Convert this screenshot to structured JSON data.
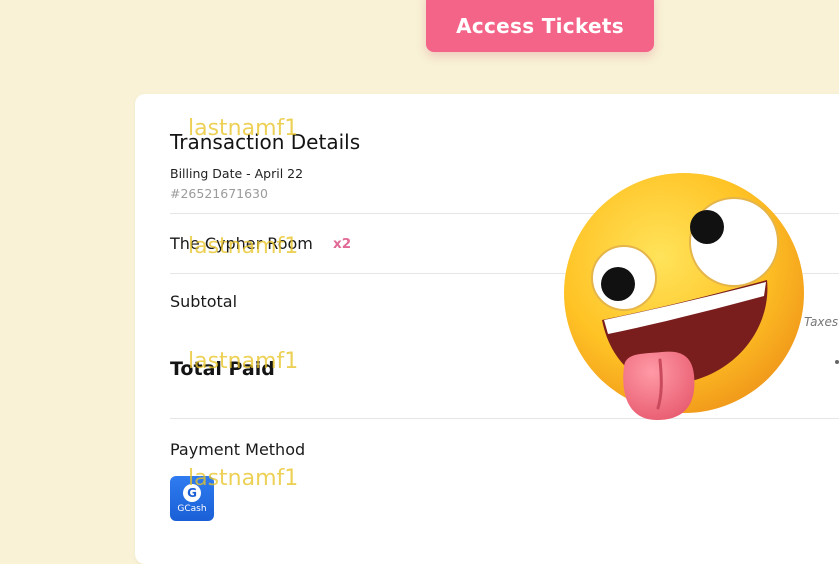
{
  "header": {
    "access_label": "Access Tickets"
  },
  "transaction": {
    "title": "Transaction Details",
    "billing_date": "Billing Date - April 22",
    "order_id": "#26521671630",
    "item": {
      "name": "The Cypher Room",
      "qty": "x2"
    },
    "subtotal_label": "Subtotal",
    "taxes_label": "Taxes",
    "total_label": "Total Paid",
    "payment_method_label": "Payment Method",
    "payment_logo_label": "GCash"
  },
  "watermark": "lastnamf1",
  "emoji_icon": "zany-face-tongue-out-icon",
  "colors": {
    "background": "#f9f2d6",
    "accent": "#f46388",
    "quantity": "#e06a95",
    "gcash_blue": "#1a5fd6",
    "watermark": "#e8c428"
  }
}
